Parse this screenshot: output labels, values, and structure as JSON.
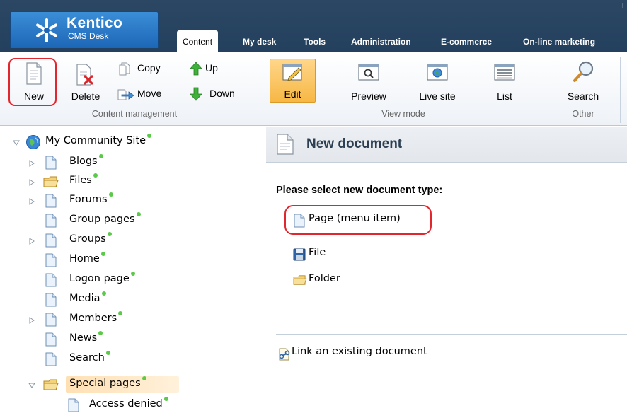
{
  "app": {
    "brand": "Kentico",
    "product": "CMS Desk",
    "corner_mark": "I"
  },
  "tabs": [
    {
      "label": "Content",
      "active": true
    },
    {
      "label": "My desk"
    },
    {
      "label": "Tools"
    },
    {
      "label": "Administration"
    },
    {
      "label": "E-commerce"
    },
    {
      "label": "On-line marketing"
    }
  ],
  "ribbon": {
    "content_management": {
      "label": "Content management",
      "new": "New",
      "delete": "Delete",
      "copy": "Copy",
      "move": "Move",
      "up": "Up",
      "down": "Down"
    },
    "view_mode": {
      "label": "View mode",
      "edit": "Edit",
      "preview": "Preview",
      "live_site": "Live site",
      "list": "List"
    },
    "other": {
      "label": "Other",
      "search": "Search"
    }
  },
  "tree": {
    "root": "My Community Site",
    "items": [
      {
        "label": "Blogs",
        "expandable": true,
        "icon": "page-icon"
      },
      {
        "label": "Files",
        "expandable": true,
        "icon": "folder-icon"
      },
      {
        "label": "Forums",
        "expandable": true,
        "icon": "page-icon"
      },
      {
        "label": "Group pages",
        "expandable": false,
        "icon": "page-icon"
      },
      {
        "label": "Groups",
        "expandable": true,
        "icon": "page-icon"
      },
      {
        "label": "Home",
        "expandable": false,
        "icon": "page-icon"
      },
      {
        "label": "Logon page",
        "expandable": false,
        "icon": "page-icon"
      },
      {
        "label": "Media",
        "expandable": false,
        "icon": "page-icon"
      },
      {
        "label": "Members",
        "expandable": true,
        "icon": "page-icon"
      },
      {
        "label": "News",
        "expandable": false,
        "icon": "page-icon"
      },
      {
        "label": "Search",
        "expandable": false,
        "icon": "page-icon"
      },
      {
        "label": "Special pages",
        "expanded": true,
        "selected": true,
        "icon": "folder-icon"
      },
      {
        "label": "Access denied",
        "child": true,
        "icon": "page-icon"
      }
    ]
  },
  "panel": {
    "title": "New document",
    "prompt": "Please select new document type:",
    "types": [
      {
        "label": "Page (menu item)",
        "icon": "page-icon"
      },
      {
        "label": "File",
        "icon": "floppy-disk-icon"
      },
      {
        "label": "Folder",
        "icon": "folder-icon"
      }
    ],
    "link_existing": "Link an existing document"
  },
  "colors": {
    "header_bg": "#2b4763",
    "logo_blue": "#2a7ccc",
    "highlight_red": "#e2262d",
    "status_green": "#5cc94a",
    "selection_orange": "#ffe0b3"
  }
}
